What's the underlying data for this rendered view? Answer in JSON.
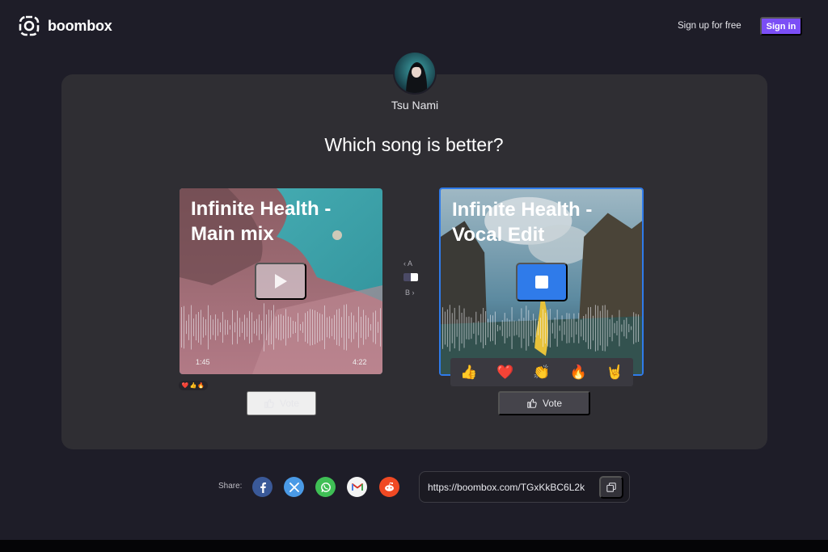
{
  "header": {
    "logo_text": "boombox",
    "signup_label": "Sign up for free",
    "signin_label": "Sign in"
  },
  "poll": {
    "author": "Tsu Nami",
    "question": "Which song is better?"
  },
  "songs": [
    {
      "title": "Infinite Health - Main mix",
      "elapsed": "1:45",
      "duration": "4:22",
      "state": "paused",
      "reactions": [
        "❤️",
        "👍",
        "🔥"
      ],
      "vote_label": "Vote"
    },
    {
      "title": "Infinite Health - Vocal Edit",
      "state": "playing",
      "reactions_menu": [
        "👍",
        "❤️",
        "👏",
        "🔥",
        "🤘"
      ],
      "vote_label": "Vote"
    }
  ],
  "toggle": {
    "a_label": "‹ A",
    "b_label": "B ›"
  },
  "share": {
    "label": "Share:",
    "services": [
      "facebook",
      "x",
      "whatsapp",
      "gmail",
      "reddit"
    ],
    "url": "https://boombox.com/TGxKkBC6L2k"
  },
  "colors": {
    "accent": "#7b4ef6",
    "playing_highlight": "#2f7bea",
    "background": "#1e1d28",
    "card": "#2f2e33"
  }
}
